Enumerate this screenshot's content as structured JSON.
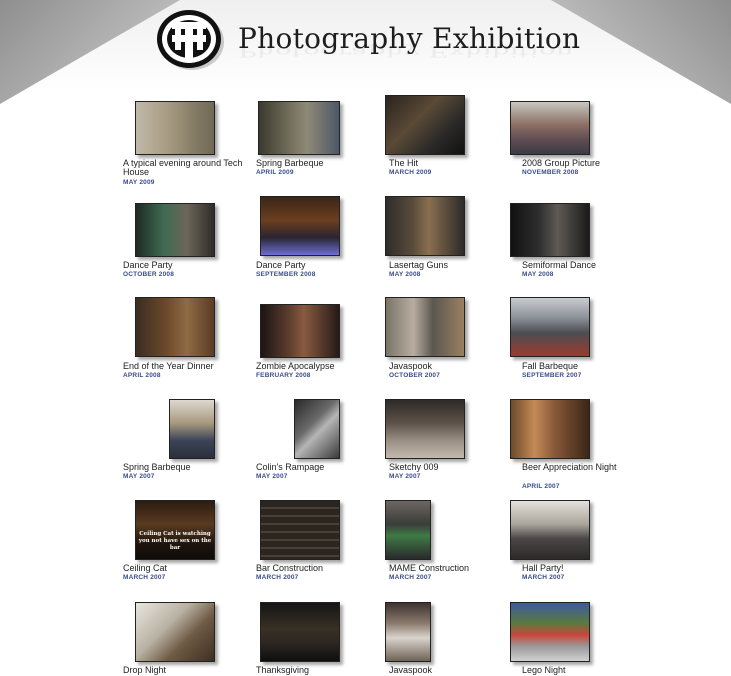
{
  "header": {
    "title": "Photography Exhibition",
    "logo_icon": "tech-house-logo"
  },
  "gallery": {
    "rows": [
      [
        {
          "caption": "A typical evening around Tech House",
          "date": "MAY 2009"
        },
        {
          "caption": "Spring Barbeque",
          "date": "APRIL 2009"
        },
        {
          "caption": "The Hit",
          "date": "MARCH 2009"
        },
        {
          "caption": "2008 Group Picture",
          "date": "NOVEMBER 2008"
        }
      ],
      [
        {
          "caption": "Dance Party",
          "date": "OCTOBER 2008"
        },
        {
          "caption": "Dance Party",
          "date": "SEPTEMBER 2008"
        },
        {
          "caption": "Lasertag Guns",
          "date": "MAY 2008"
        },
        {
          "caption": "Semiformal Dance",
          "date": "MAY 2008"
        }
      ],
      [
        {
          "caption": "End of the Year Dinner",
          "date": "APRIL 2008"
        },
        {
          "caption": "Zombie Apocalypse",
          "date": "FEBRUARY 2008"
        },
        {
          "caption": "Javaspook",
          "date": "OCTOBER 2007"
        },
        {
          "caption": "Fall Barbeque",
          "date": "SEPTEMBER 2007"
        }
      ],
      [
        {
          "caption": "Spring Barbeque",
          "date": "MAY 2007"
        },
        {
          "caption": "Colin's Rampage",
          "date": "MAY 2007"
        },
        {
          "caption": "Sketchy 009",
          "date": "MAY 2007"
        },
        {
          "caption": "Beer Appreciation Night",
          "date": "APRIL 2007"
        }
      ],
      [
        {
          "caption": "Ceiling Cat",
          "date": "MARCH 2007",
          "photo_text": "Ceiling Cat is watching you not have sex on the bar"
        },
        {
          "caption": "Bar Construction",
          "date": "MARCH 2007"
        },
        {
          "caption": "MAME Construction",
          "date": "MARCH 2007"
        },
        {
          "caption": "Hall Party!",
          "date": "MARCH 2007"
        }
      ],
      [
        {
          "caption": "Drop Night",
          "date": ""
        },
        {
          "caption": "Thanksgiving",
          "date": ""
        },
        {
          "caption": "Javaspook",
          "date": ""
        },
        {
          "caption": "Lego Night",
          "date": ""
        }
      ]
    ]
  }
}
